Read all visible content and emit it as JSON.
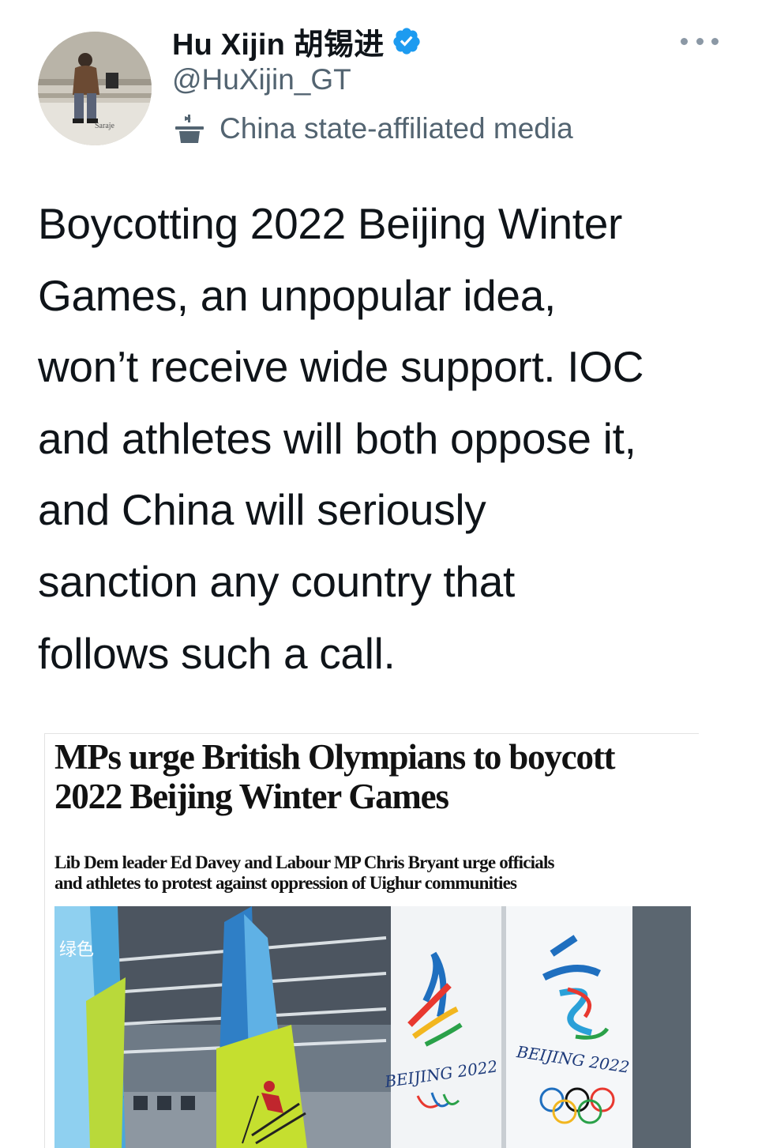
{
  "author": {
    "display_name": "Hu Xijin 胡锡进",
    "handle": "@HuXijin_GT",
    "label": "China state-affiliated media",
    "avatar_caption": "Saraje",
    "verified": true
  },
  "icons": {
    "verified": "verified-badge-icon",
    "label": "state-media-podium-icon",
    "more": "more-options-icon"
  },
  "colors": {
    "verified_blue": "#1d9bf0",
    "secondary_text": "#536471"
  },
  "tweet": {
    "lines": [
      "Boycotting 2022 Beijing Winter",
      "Games, an unpopular idea,",
      "won’t receive wide support. IOC",
      "and athletes will both oppose it,",
      "and China will seriously",
      "sanction any country that",
      "follows such a call."
    ]
  },
  "media": {
    "headline_lines": [
      "MPs urge British Olympians to boycott",
      "2022 Beijing Winter Games"
    ],
    "standfirst_lines": [
      "Lib Dem leader Ed Davey and Labour MP Chris Bryant urge officials",
      "and athletes to protest against oppression of Uighur communities"
    ],
    "photo": {
      "banner_text": "绿色",
      "paralympic_text": "BEIJING 2022",
      "olympic_text": "BEIJING 2022"
    }
  }
}
